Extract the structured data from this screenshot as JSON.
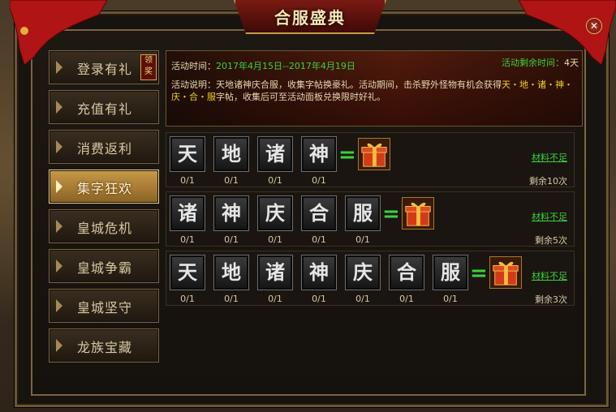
{
  "window": {
    "title": "合服盛典",
    "close_label": "✕"
  },
  "sidebar": {
    "items": [
      {
        "label": "登录有礼",
        "active": false,
        "tag": "领奖"
      },
      {
        "label": "充值有礼",
        "active": false
      },
      {
        "label": "消费返利",
        "active": false
      },
      {
        "label": "集字狂欢",
        "active": true
      },
      {
        "label": "皇城危机",
        "active": false
      },
      {
        "label": "皇城争霸",
        "active": false
      },
      {
        "label": "皇城坚守",
        "active": false
      },
      {
        "label": "龙族宝藏",
        "active": false
      }
    ]
  },
  "banner": {
    "time_label": "活动时间：",
    "time_value": "2017年4月15日--2017年4月19日",
    "remain_label": "活动剩余时间：",
    "remain_value": "4天",
    "desc_prefix": "活动说明：天地诸神庆合服，收集字帖换豪礼。活动期间，击杀野外怪物有机会获得",
    "desc_highlight": "天・地・诸・神・庆・合・服",
    "desc_suffix": "字帖，收集后可至活动面板兑换限时好礼。"
  },
  "rows": [
    {
      "chars": [
        "天",
        "地",
        "诸",
        "神"
      ],
      "counts": [
        "0/1",
        "0/1",
        "0/1",
        "0/1"
      ],
      "status": "材料不足",
      "remaining": "剩余10次"
    },
    {
      "chars": [
        "诸",
        "神",
        "庆",
        "合",
        "服"
      ],
      "counts": [
        "0/1",
        "0/1",
        "0/1",
        "0/1",
        "0/1"
      ],
      "status": "材料不足",
      "remaining": "剩余5次"
    },
    {
      "chars": [
        "天",
        "地",
        "诸",
        "神",
        "庆",
        "合",
        "服"
      ],
      "counts": [
        "0/1",
        "0/1",
        "0/1",
        "0/1",
        "0/1",
        "0/1",
        "0/1"
      ],
      "status": "材料不足",
      "remaining": "剩余3次"
    }
  ],
  "equals_sign": "=",
  "icons": {
    "gift": "gift-box-icon",
    "close": "close-icon",
    "arrow": "arrow-right-icon"
  },
  "colors": {
    "accent_green": "#3bd23b",
    "highlight_yellow": "#f0d020",
    "gold": "#c89b4d"
  }
}
